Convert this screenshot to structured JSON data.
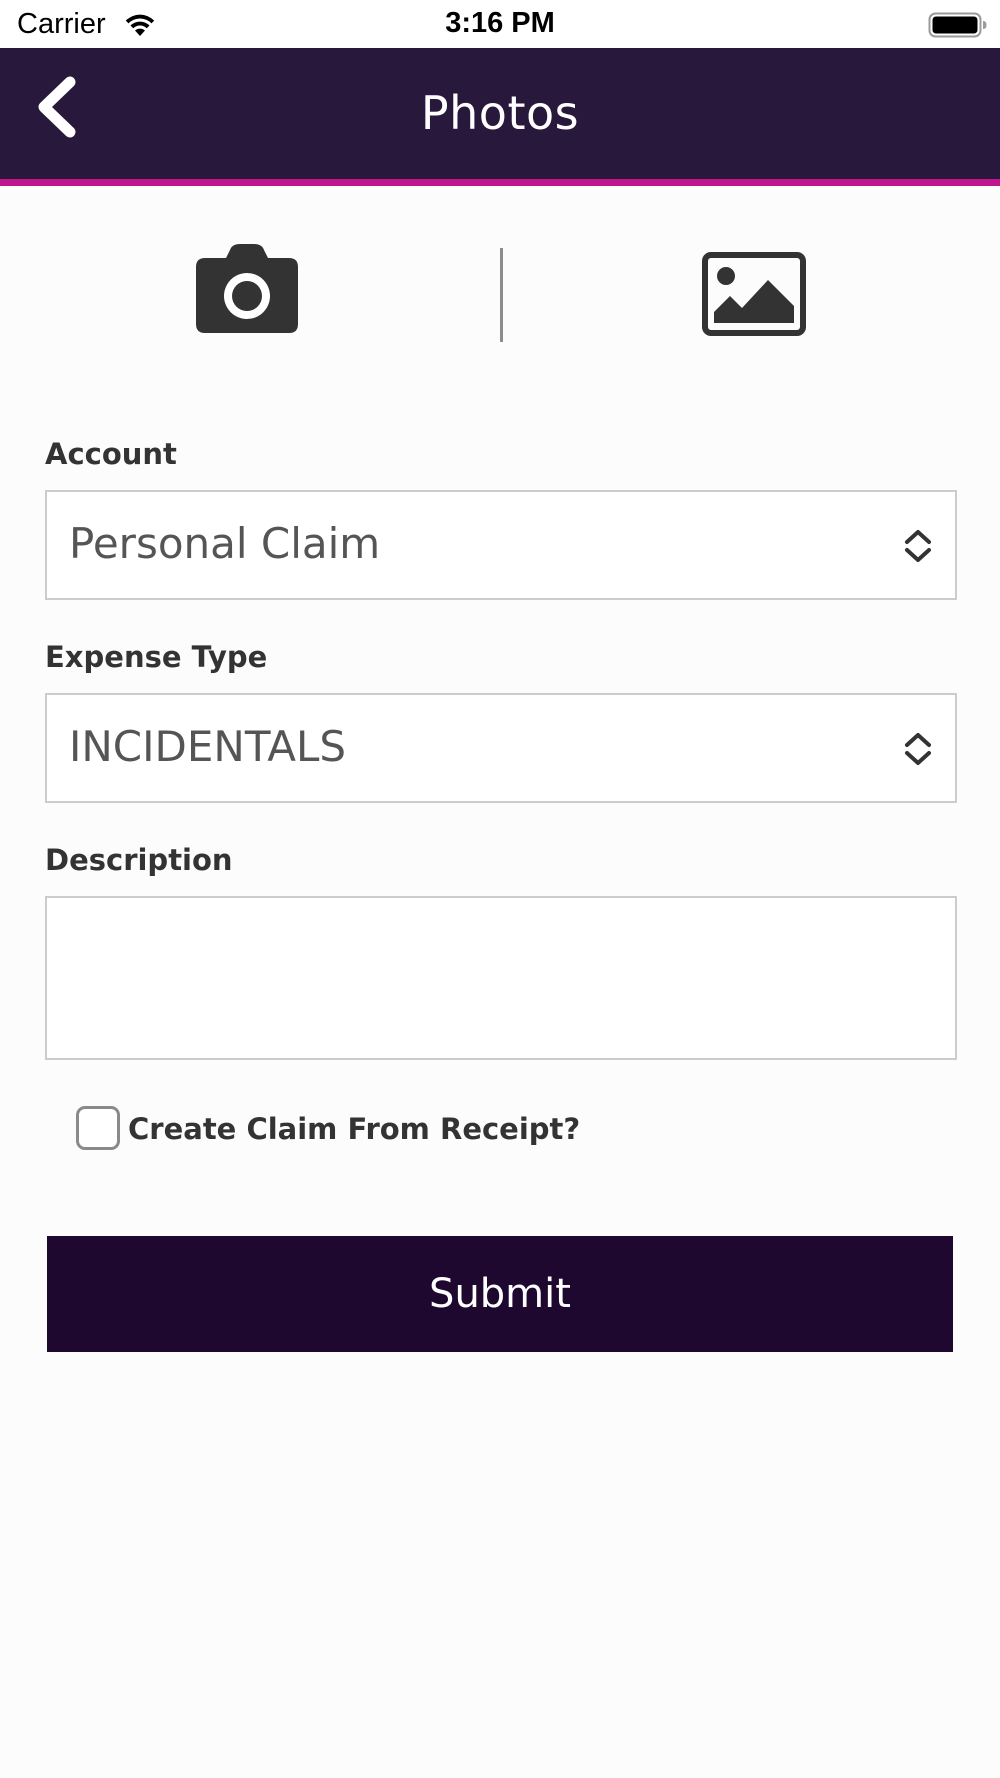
{
  "status_bar": {
    "carrier": "Carrier",
    "time": "3:16 PM",
    "icons": [
      "wifi-icon",
      "battery-icon"
    ]
  },
  "nav": {
    "title": "Photos",
    "back_icon": "chevron-left-icon",
    "background_color": "#28183c",
    "accent_color": "#c0148c"
  },
  "photo_sources": {
    "camera_icon": "camera-icon",
    "gallery_icon": "image-icon"
  },
  "form": {
    "account": {
      "label": "Account",
      "value": "Personal Claim"
    },
    "expense_type": {
      "label": "Expense Type",
      "value": "INCIDENTALS"
    },
    "description": {
      "label": "Description",
      "value": ""
    },
    "create_claim": {
      "label": "Create Claim From Receipt?",
      "checked": false
    },
    "submit_label": "Submit",
    "submit_color": "#1e0830"
  }
}
